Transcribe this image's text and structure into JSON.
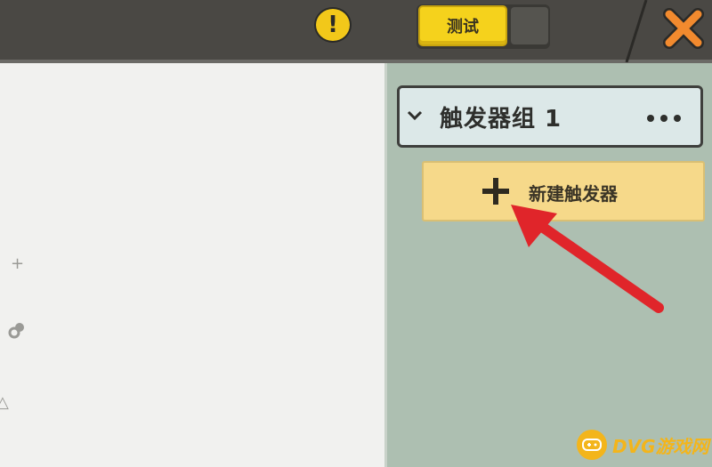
{
  "toolbar": {
    "warning_glyph": "!",
    "test_label": "测试",
    "close_icon": "close-icon",
    "accent": "#f5d21c"
  },
  "side_tools": {
    "add_glyph": "+",
    "shape_glyph": "△"
  },
  "trigger_panel": {
    "group_title": "触发器组 1",
    "more_icon": "more-icon",
    "new_trigger_label": "新建触发器",
    "new_trigger_color": "#f6d98a"
  },
  "annotation": {
    "arrow_color": "#e0252a"
  },
  "watermark": {
    "text": "DVG游戏网"
  }
}
